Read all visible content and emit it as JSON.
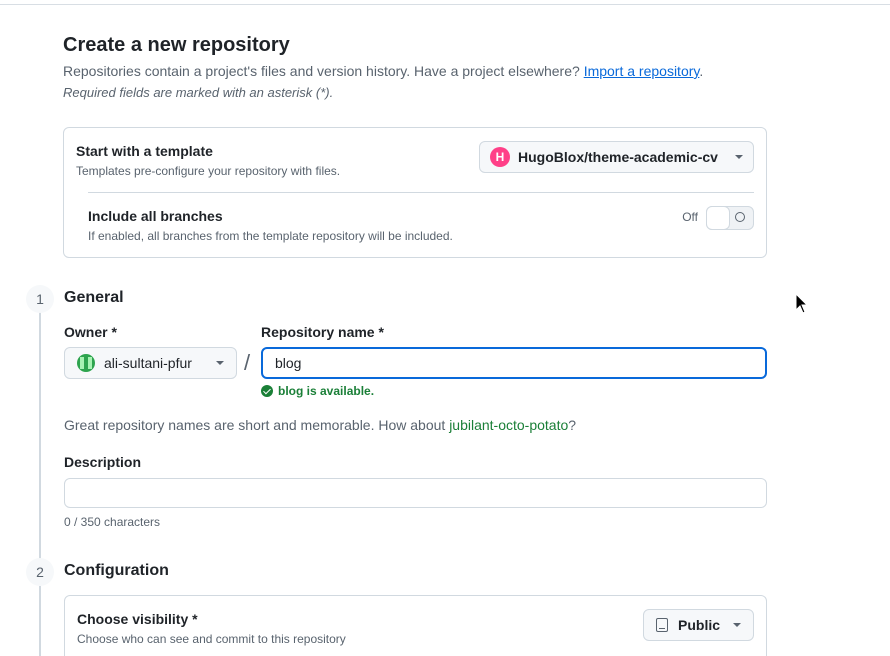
{
  "page": {
    "title": "Create a new repository",
    "subtitle": "Repositories contain a project's files and version history. Have a project elsewhere?",
    "import_link": "Import a repository",
    "subtitle_end": ".",
    "required_note": "Required fields are marked with an asterisk (*)."
  },
  "template": {
    "heading": "Start with a template",
    "description": "Templates pre-configure your repository with files.",
    "selected": "HugoBlox/theme-academic-cv",
    "logo_letter": "H",
    "branches_heading": "Include all branches",
    "branches_description": "If enabled, all branches from the template repository will be included.",
    "toggle_state": "Off"
  },
  "general": {
    "step": "1",
    "title": "General",
    "owner_label": "Owner *",
    "owner_value": "ali-sultani-pfur",
    "separator": "/",
    "repo_label": "Repository name *",
    "repo_value": "blog",
    "available_msg": "blog is available.",
    "suggestion_prefix": "Great repository names are short and memorable. How about",
    "suggestion_name": "jubilant-octo-potato",
    "suggestion_suffix": "?",
    "description_label": "Description",
    "description_value": "",
    "char_count": "0 / 350 characters"
  },
  "configuration": {
    "step": "2",
    "title": "Configuration",
    "visibility_heading": "Choose visibility *",
    "visibility_description": "Choose who can see and commit to this repository",
    "visibility_value": "Public"
  },
  "colors": {
    "accent": "#0969da",
    "success": "#1a7f37",
    "hugo_brand": "#ff4088"
  }
}
